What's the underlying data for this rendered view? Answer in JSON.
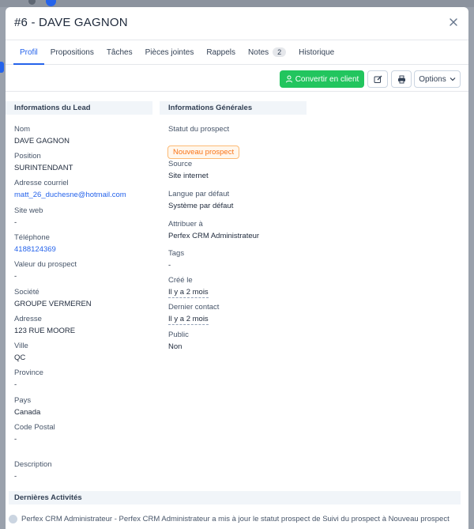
{
  "modal": {
    "title": "#6 - DAVE GAGNON"
  },
  "tabs": [
    {
      "label": "Profil"
    },
    {
      "label": "Propositions"
    },
    {
      "label": "Tâches"
    },
    {
      "label": "Pièces jointes"
    },
    {
      "label": "Rappels"
    },
    {
      "label": "Notes",
      "badge": "2"
    },
    {
      "label": "Historique"
    }
  ],
  "toolbar": {
    "convert_label": "Convertir en client",
    "options_label": "Options"
  },
  "lead_info": {
    "heading": "Informations du Lead",
    "fields": [
      {
        "label": "Nom",
        "value": "DAVE GAGNON"
      },
      {
        "label": "Position",
        "value": "SURINTENDANT"
      },
      {
        "label": "Adresse courriel",
        "value": "matt_26_duchesne@hotmail.com"
      },
      {
        "label": "Site web",
        "value": "-"
      },
      {
        "label": "Téléphone",
        "value": "4188124369"
      },
      {
        "label": "Valeur du prospect",
        "value": "-"
      },
      {
        "label": "Société",
        "value": "GROUPE VERMEREN"
      },
      {
        "label": "Adresse",
        "value": "123 RUE MOORE"
      },
      {
        "label": "Ville",
        "value": "QC"
      },
      {
        "label": "Province",
        "value": "-"
      },
      {
        "label": "Pays",
        "value": "Canada"
      },
      {
        "label": "Code Postal",
        "value": "-"
      },
      {
        "label": "Description",
        "value": "-"
      }
    ]
  },
  "general_info": {
    "heading": "Informations Générales",
    "status_label": "Statut du prospect",
    "status_value": "Nouveau prospect",
    "fields": [
      {
        "label": "Source",
        "value": "Site internet"
      },
      {
        "label": "Langue par défaut",
        "value": "Système par défaut"
      },
      {
        "label": "Attribuer à",
        "value": "Perfex CRM Administrateur"
      },
      {
        "label": "Tags",
        "value": "-"
      },
      {
        "label": "Créé le",
        "value": "Il y a 2 mois"
      },
      {
        "label": "Dernier contact",
        "value": "Il y a 2 mois"
      },
      {
        "label": "Public",
        "value": "Non"
      }
    ]
  },
  "activities": {
    "heading": "Dernières Activités",
    "items": [
      {
        "text": "Perfex CRM Administrateur - Perfex CRM Administrateur a mis à jour le statut prospect de Suivi du prospect à Nouveau prospect"
      }
    ]
  },
  "colors": {
    "accent": "#2563eb",
    "success": "#22c55e",
    "status_orange": "#f97316"
  }
}
